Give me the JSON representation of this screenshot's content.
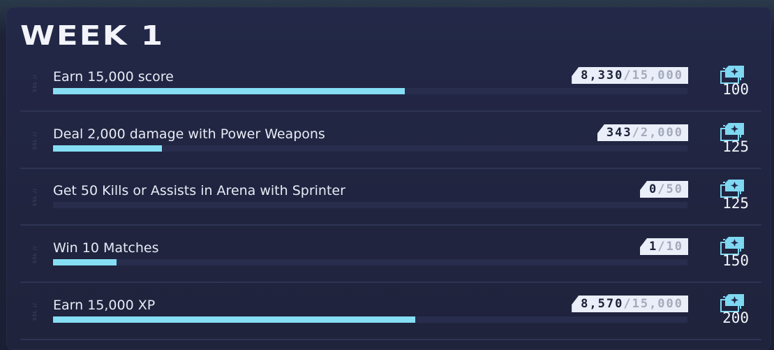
{
  "header": {
    "title": "WEEK 1"
  },
  "challenges": [
    {
      "label": "Earn 15,000 score",
      "current": "8,330",
      "total": "15,000",
      "progress": 0.555,
      "reward": "100",
      "tag": "SSL //"
    },
    {
      "label": "Deal 2,000 damage with Power Weapons",
      "current": "343",
      "total": "2,000",
      "progress": 0.1715,
      "reward": "125",
      "tag": "SSL //"
    },
    {
      "label": "Get 50 Kills or Assists in Arena with Sprinter",
      "current": "0",
      "total": "50",
      "progress": 0,
      "reward": "125",
      "tag": "SSL //"
    },
    {
      "label": "Win 10 Matches",
      "current": "1",
      "total": "10",
      "progress": 0.1,
      "reward": "150",
      "tag": "SSL //"
    },
    {
      "label": "Earn 15,000 XP",
      "current": "8,570",
      "total": "15,000",
      "progress": 0.5713,
      "reward": "200",
      "tag": "SSL //"
    }
  ],
  "counter_separator": "/",
  "reward_icon": "xp-card-stack-icon",
  "colors": {
    "progress_fill": "#86def4",
    "progress_track": "#282d4d",
    "counter_bg": "#e9eef8",
    "icon_accent": "#7fd8f2"
  }
}
